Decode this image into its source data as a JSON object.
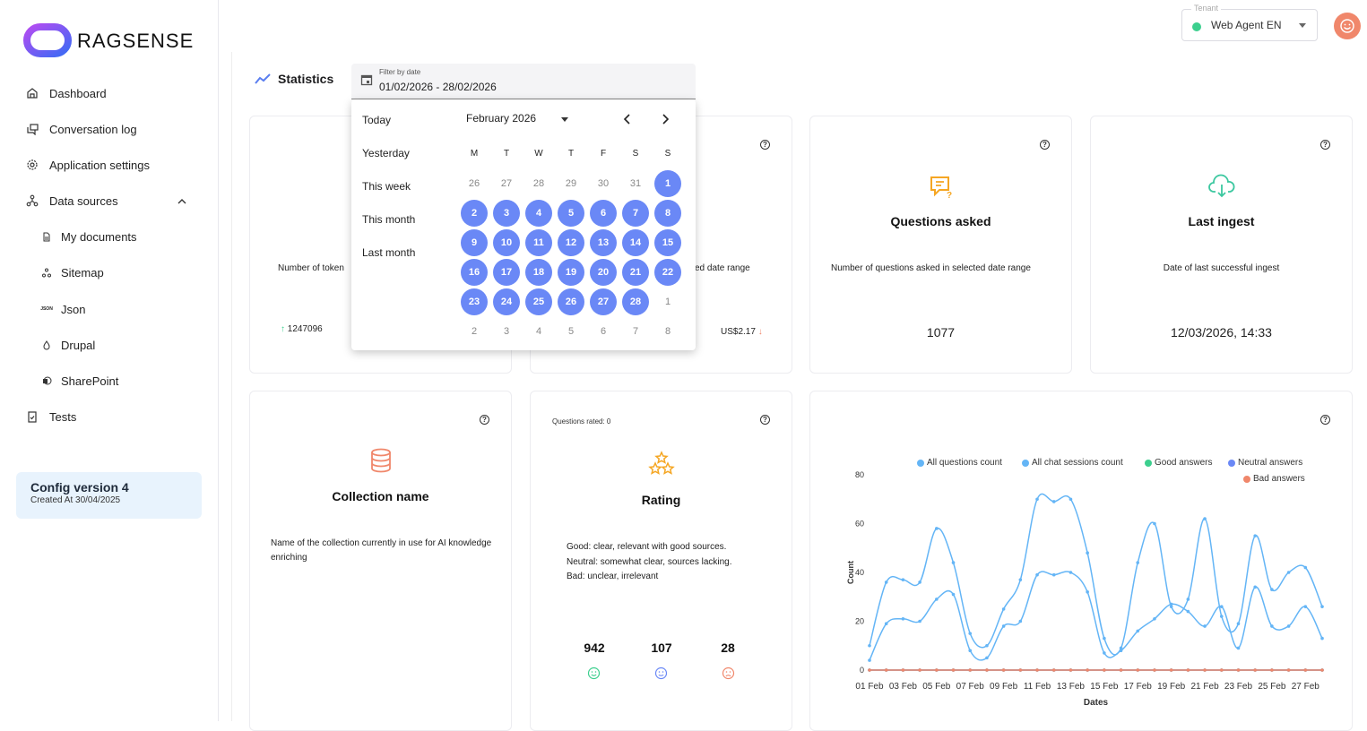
{
  "brand": {
    "name": "RAGSENSE"
  },
  "sidebar": {
    "items": [
      {
        "label": "Dashboard",
        "icon": "home-icon"
      },
      {
        "label": "Conversation log",
        "icon": "chat-log-icon"
      },
      {
        "label": "Application settings",
        "icon": "gear-icon"
      },
      {
        "label": "Data sources",
        "icon": "data-sources-icon"
      }
    ],
    "subitems": [
      {
        "label": "My documents",
        "icon": "document-icon"
      },
      {
        "label": "Sitemap",
        "icon": "sitemap-icon"
      },
      {
        "label": "Json",
        "icon": "json-icon"
      },
      {
        "label": "Drupal",
        "icon": "drupal-icon"
      },
      {
        "label": "SharePoint",
        "icon": "sharepoint-icon"
      }
    ],
    "tests": {
      "label": "Tests",
      "icon": "clipboard-check-icon"
    },
    "config": {
      "title": "Config version 4",
      "created": "Created At 30/04/2025"
    }
  },
  "topbar": {
    "tenant_label": "Tenant",
    "tenant_value": "Web Agent EN",
    "json_icon_text": "JSON"
  },
  "page": {
    "title": "Statistics",
    "date_filter_label": "Filter by date",
    "date_filter_value": "01/02/2026 - 28/02/2026"
  },
  "datepicker": {
    "quick": [
      "Today",
      "Yesterday",
      "This week",
      "This month",
      "Last month"
    ],
    "month_label": "February 2026",
    "dow": [
      "M",
      "T",
      "W",
      "T",
      "F",
      "S",
      "S"
    ],
    "rows": [
      [
        "26",
        "27",
        "28",
        "29",
        "30",
        "31",
        "1"
      ],
      [
        "2",
        "3",
        "4",
        "5",
        "6",
        "7",
        "8"
      ],
      [
        "9",
        "10",
        "11",
        "12",
        "13",
        "14",
        "15"
      ],
      [
        "16",
        "17",
        "18",
        "19",
        "20",
        "21",
        "22"
      ],
      [
        "23",
        "24",
        "25",
        "26",
        "27",
        "28",
        "1"
      ],
      [
        "2",
        "3",
        "4",
        "5",
        "6",
        "7",
        "8"
      ]
    ]
  },
  "cards": {
    "tokens": {
      "desc_partial": "Number of token",
      "value": "1247096",
      "arrow": "↑"
    },
    "cost": {
      "desc_partial": "ed date range",
      "value": "US$2.17",
      "arrow": "↓"
    },
    "questions": {
      "title": "Questions asked",
      "desc": "Number of questions asked in selected date range",
      "value": "1077"
    },
    "ingest": {
      "title": "Last ingest",
      "desc": "Date of last successful ingest",
      "value": "12/03/2026, 14:33"
    },
    "collection": {
      "title": "Collection name",
      "desc": "Name of the collection currently in use for AI knowledge enriching"
    },
    "rating": {
      "rated_label": "Questions rated: 0",
      "title": "Rating",
      "desc_good": "Good: clear, relevant with good sources.",
      "desc_neutral": "Neutral: somewhat clear, sources lacking.",
      "desc_bad": "Bad: unclear, irrelevant",
      "good": "942",
      "neutral": "107",
      "bad": "28"
    }
  },
  "chart_data": {
    "type": "line",
    "xlabel": "Dates",
    "ylabel": "Count",
    "ylim": [
      0,
      80
    ],
    "yticks": [
      "0",
      "20",
      "40",
      "60",
      "80"
    ],
    "xticks": [
      "01 Feb",
      "03 Feb",
      "05 Feb",
      "07 Feb",
      "09 Feb",
      "11 Feb",
      "13 Feb",
      "15 Feb",
      "17 Feb",
      "19 Feb",
      "21 Feb",
      "23 Feb",
      "25 Feb",
      "27 Feb"
    ],
    "x": [
      "01 Feb",
      "02 Feb",
      "03 Feb",
      "04 Feb",
      "05 Feb",
      "06 Feb",
      "07 Feb",
      "08 Feb",
      "09 Feb",
      "10 Feb",
      "11 Feb",
      "12 Feb",
      "13 Feb",
      "14 Feb",
      "15 Feb",
      "16 Feb",
      "17 Feb",
      "18 Feb",
      "19 Feb",
      "20 Feb",
      "21 Feb",
      "22 Feb",
      "23 Feb",
      "24 Feb",
      "25 Feb",
      "26 Feb",
      "27 Feb",
      "28 Feb"
    ],
    "series": [
      {
        "name": "All questions count",
        "color": "#64b5f6",
        "values": [
          10,
          36,
          37,
          36,
          58,
          44,
          15,
          10,
          25,
          37,
          70,
          69,
          70,
          48,
          13,
          9,
          44,
          60,
          26,
          29,
          62,
          22,
          19,
          55,
          33,
          40,
          42,
          26
        ]
      },
      {
        "name": "All chat sessions count",
        "color": "#64b5f6",
        "values": [
          4,
          19,
          21,
          20,
          29,
          31,
          8,
          5,
          18,
          20,
          39,
          39,
          40,
          32,
          7,
          8,
          16,
          21,
          27,
          24,
          18,
          26,
          9,
          34,
          18,
          18,
          26,
          13
        ]
      },
      {
        "name": "Good answers",
        "color": "#3ccf8e",
        "values": [
          0,
          0,
          0,
          0,
          0,
          0,
          0,
          0,
          0,
          0,
          0,
          0,
          0,
          0,
          0,
          0,
          0,
          0,
          0,
          0,
          0,
          0,
          0,
          0,
          0,
          0,
          0,
          0
        ]
      },
      {
        "name": "Neutral answers",
        "color": "#6a88f6",
        "values": [
          0,
          0,
          0,
          0,
          0,
          0,
          0,
          0,
          0,
          0,
          0,
          0,
          0,
          0,
          0,
          0,
          0,
          0,
          0,
          0,
          0,
          0,
          0,
          0,
          0,
          0,
          0,
          0
        ]
      },
      {
        "name": "Bad answers",
        "color": "#f0876b",
        "values": [
          0,
          0,
          0,
          0,
          0,
          0,
          0,
          0,
          0,
          0,
          0,
          0,
          0,
          0,
          0,
          0,
          0,
          0,
          0,
          0,
          0,
          0,
          0,
          0,
          0,
          0,
          0,
          0
        ]
      }
    ],
    "legend_position": "top-right",
    "grid": false
  }
}
